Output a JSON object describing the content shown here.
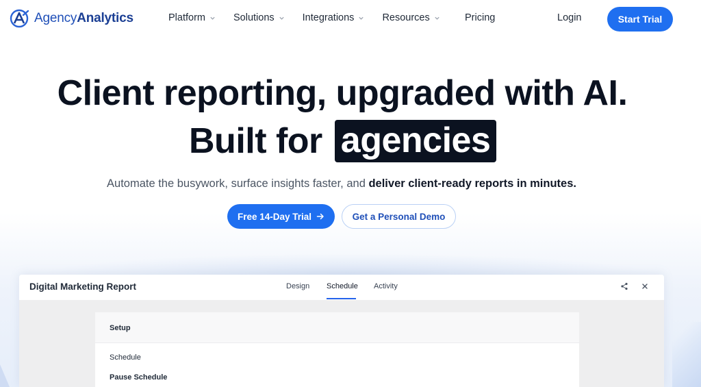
{
  "brand": {
    "name_light": "Agency",
    "name_bold": "Analytics",
    "accent": "#1f6ff0"
  },
  "nav": {
    "items": [
      {
        "label": "Platform"
      },
      {
        "label": "Solutions"
      },
      {
        "label": "Integrations"
      },
      {
        "label": "Resources"
      }
    ],
    "pricing": "Pricing",
    "login": "Login",
    "start_trial": "Start Trial"
  },
  "hero": {
    "line1": "Client reporting, upgraded with AI.",
    "line2_prefix": "Built for",
    "line2_highlight": "agencies",
    "sub_plain": "Automate the busywork, surface insights faster, and ",
    "sub_bold": "deliver client-ready reports in minutes.",
    "cta_primary": "Free 14-Day Trial",
    "cta_primary_icon": "arrow-right-icon",
    "cta_secondary": "Get a Personal Demo"
  },
  "preview": {
    "title": "Digital Marketing Report",
    "tabs": [
      {
        "label": "Design"
      },
      {
        "label": "Schedule",
        "active": true
      },
      {
        "label": "Activity"
      }
    ],
    "icons": [
      "share-icon",
      "close-icon"
    ],
    "card": {
      "header": "Setup",
      "schedule_label": "Schedule",
      "pause_label": "Pause Schedule"
    }
  }
}
